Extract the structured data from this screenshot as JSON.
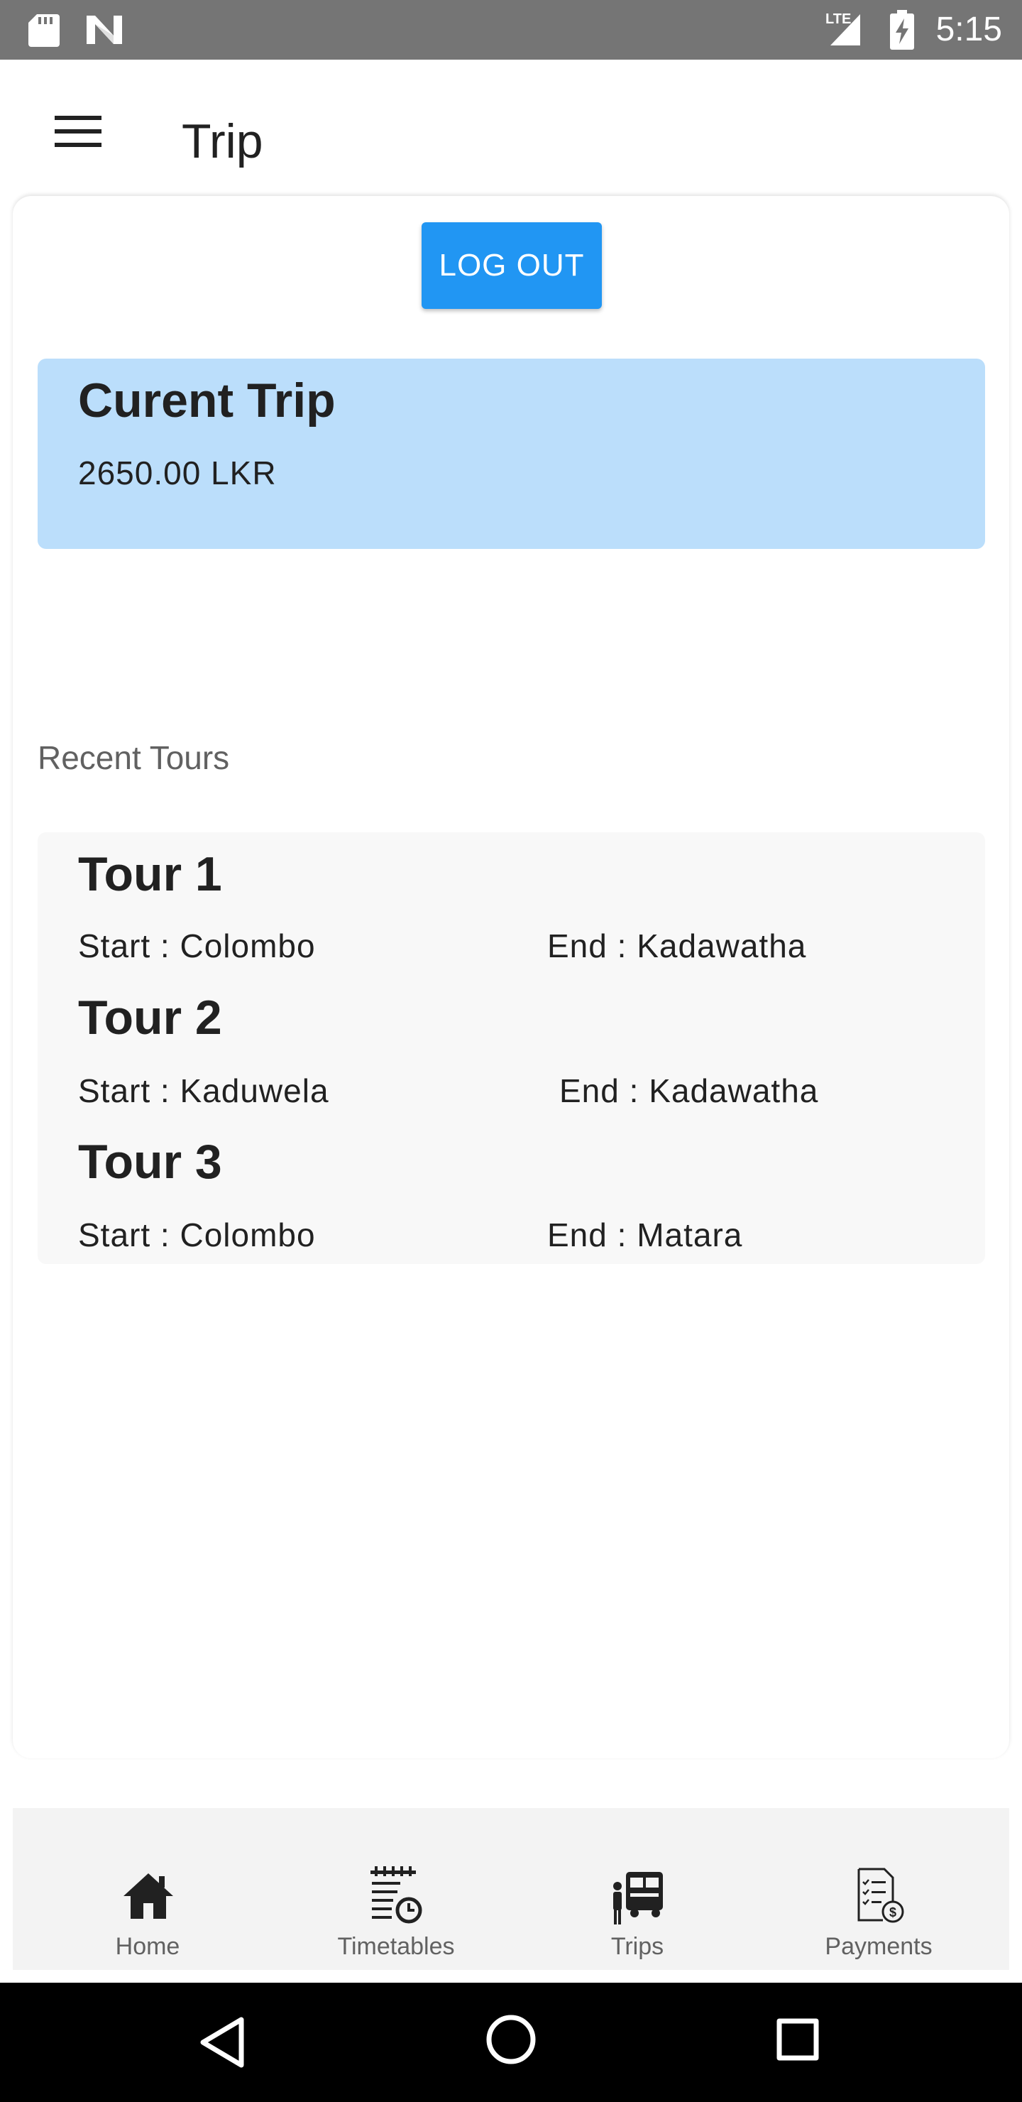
{
  "status_bar": {
    "time": "5:15",
    "network": "LTE",
    "icons": [
      "sd-card-icon",
      "n-logo-icon",
      "lte-signal-icon",
      "battery-charging-icon"
    ]
  },
  "app_bar": {
    "title": "Trip",
    "menu_icon": "hamburger-menu-icon"
  },
  "logout_button": {
    "label": "LOG OUT",
    "color": "#2196f3"
  },
  "current_trip": {
    "title": "Curent Trip",
    "amount": "2650.00 LKR",
    "background": "#bbdefb"
  },
  "recent_tours": {
    "label": "Recent Tours",
    "tours": [
      {
        "name": "Tour 1",
        "start": "Start : Colombo",
        "end": "End : Kadawatha"
      },
      {
        "name": "Tour 2",
        "start": "Start : Kaduwela",
        "end": "End : Kadawatha"
      },
      {
        "name": "Tour 3",
        "start": "Start : Colombo",
        "end": "End : Matara"
      }
    ]
  },
  "bottom_nav": {
    "items": [
      {
        "label": "Home",
        "icon": "home-icon"
      },
      {
        "label": "Timetables",
        "icon": "timetable-icon"
      },
      {
        "label": "Trips",
        "icon": "trips-bus-icon"
      },
      {
        "label": "Payments",
        "icon": "payments-icon"
      }
    ]
  },
  "system_nav": {
    "buttons": [
      "back-icon",
      "home-circle-icon",
      "recents-icon"
    ]
  }
}
